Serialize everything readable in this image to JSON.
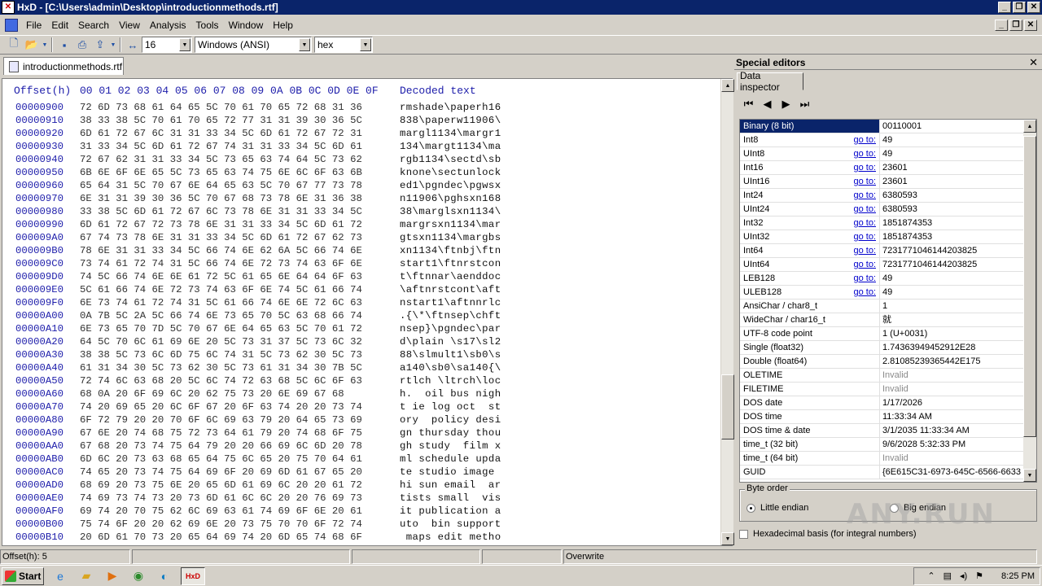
{
  "title": "HxD - [C:\\Users\\admin\\Desktop\\introductionmethods.rtf]",
  "menu": [
    "File",
    "Edit",
    "Search",
    "View",
    "Analysis",
    "Tools",
    "Window",
    "Help"
  ],
  "toolbar": {
    "bytes_per_row": "16",
    "charset": "Windows (ANSI)",
    "offset_base": "hex"
  },
  "file_tab": "introductionmethods.rtf",
  "hex": {
    "header_offset": "Offset(h)",
    "header_columns": [
      "00",
      "01",
      "02",
      "03",
      "04",
      "05",
      "06",
      "07",
      "08",
      "09",
      "0A",
      "0B",
      "0C",
      "0D",
      "0E",
      "0F"
    ],
    "header_decoded": "Decoded text",
    "rows": [
      {
        "off": "00000900",
        "bytes": "72 6D 73 68 61 64 65 5C 70 61 70 65 72 68 31 36",
        "text": "rmshade\\paperh16"
      },
      {
        "off": "00000910",
        "bytes": "38 33 38 5C 70 61 70 65 72 77 31 31 39 30 36 5C",
        "text": "838\\paperw11906\\"
      },
      {
        "off": "00000920",
        "bytes": "6D 61 72 67 6C 31 31 33 34 5C 6D 61 72 67 72 31",
        "text": "margl1134\\margr1"
      },
      {
        "off": "00000930",
        "bytes": "31 33 34 5C 6D 61 72 67 74 31 31 33 34 5C 6D 61",
        "text": "134\\margt1134\\ma"
      },
      {
        "off": "00000940",
        "bytes": "72 67 62 31 31 33 34 5C 73 65 63 74 64 5C 73 62",
        "text": "rgb1134\\sectd\\sb"
      },
      {
        "off": "00000950",
        "bytes": "6B 6E 6F 6E 65 5C 73 65 63 74 75 6E 6C 6F 63 6B",
        "text": "knone\\sectunlock"
      },
      {
        "off": "00000960",
        "bytes": "65 64 31 5C 70 67 6E 64 65 63 5C 70 67 77 73 78",
        "text": "ed1\\pgndec\\pgwsx"
      },
      {
        "off": "00000970",
        "bytes": "6E 31 31 39 30 36 5C 70 67 68 73 78 6E 31 36 38",
        "text": "n11906\\pghsxn168"
      },
      {
        "off": "00000980",
        "bytes": "33 38 5C 6D 61 72 67 6C 73 78 6E 31 31 33 34 5C",
        "text": "38\\marglsxn1134\\"
      },
      {
        "off": "00000990",
        "bytes": "6D 61 72 67 72 73 78 6E 31 31 33 34 5C 6D 61 72",
        "text": "margrsxn1134\\mar"
      },
      {
        "off": "000009A0",
        "bytes": "67 74 73 78 6E 31 31 33 34 5C 6D 61 72 67 62 73",
        "text": "gtsxn1134\\margbs"
      },
      {
        "off": "000009B0",
        "bytes": "78 6E 31 31 33 34 5C 66 74 6E 62 6A 5C 66 74 6E",
        "text": "xn1134\\ftnbj\\ftn"
      },
      {
        "off": "000009C0",
        "bytes": "73 74 61 72 74 31 5C 66 74 6E 72 73 74 63 6F 6E",
        "text": "start1\\ftnrstcon"
      },
      {
        "off": "000009D0",
        "bytes": "74 5C 66 74 6E 6E 61 72 5C 61 65 6E 64 64 6F 63",
        "text": "t\\ftnnar\\aenddoc"
      },
      {
        "off": "000009E0",
        "bytes": "5C 61 66 74 6E 72 73 74 63 6F 6E 74 5C 61 66 74",
        "text": "\\aftnrstcont\\aft"
      },
      {
        "off": "000009F0",
        "bytes": "6E 73 74 61 72 74 31 5C 61 66 74 6E 6E 72 6C 63",
        "text": "nstart1\\aftnnrlc"
      },
      {
        "off": "00000A00",
        "bytes": "0A 7B 5C 2A 5C 66 74 6E 73 65 70 5C 63 68 66 74",
        "text": ".{\\*\\ftnsep\\chft"
      },
      {
        "off": "00000A10",
        "bytes": "6E 73 65 70 7D 5C 70 67 6E 64 65 63 5C 70 61 72",
        "text": "nsep}\\pgndec\\par"
      },
      {
        "off": "00000A20",
        "bytes": "64 5C 70 6C 61 69 6E 20 5C 73 31 37 5C 73 6C 32",
        "text": "d\\plain \\s17\\sl2"
      },
      {
        "off": "00000A30",
        "bytes": "38 38 5C 73 6C 6D 75 6C 74 31 5C 73 62 30 5C 73",
        "text": "88\\slmult1\\sb0\\s"
      },
      {
        "off": "00000A40",
        "bytes": "61 31 34 30 5C 73 62 30 5C 73 61 31 34 30 7B 5C",
        "text": "a140\\sb0\\sa140{\\"
      },
      {
        "off": "00000A50",
        "bytes": "72 74 6C 63 68 20 5C 6C 74 72 63 68 5C 6C 6F 63",
        "text": "rtlch \\ltrch\\loc"
      },
      {
        "off": "00000A60",
        "bytes": "68 0A 20 6F 69 6C 20 62 75 73 20 6E 69 67 68",
        "text": "h.  oil bus nigh"
      },
      {
        "off": "00000A70",
        "bytes": "74 20 69 65 20 6C 6F 67 20 6F 63 74 20 20 73 74",
        "text": "t ie log oct  st"
      },
      {
        "off": "00000A80",
        "bytes": "6F 72 79 20 20 70 6F 6C 69 63 79 20 64 65 73 69",
        "text": "ory  policy desi"
      },
      {
        "off": "00000A90",
        "bytes": "67 6E 20 74 68 75 72 73 64 61 79 20 74 68 6F 75",
        "text": "gn thursday thou"
      },
      {
        "off": "00000AA0",
        "bytes": "67 68 20 73 74 75 64 79 20 20 66 69 6C 6D 20 78",
        "text": "gh study  film x"
      },
      {
        "off": "00000AB0",
        "bytes": "6D 6C 20 73 63 68 65 64 75 6C 65 20 75 70 64 61",
        "text": "ml schedule upda"
      },
      {
        "off": "00000AC0",
        "bytes": "74 65 20 73 74 75 64 69 6F 20 69 6D 61 67 65 20",
        "text": "te studio image "
      },
      {
        "off": "00000AD0",
        "bytes": "68 69 20 73 75 6E 20 65 6D 61 69 6C 20 20 61 72",
        "text": "hi sun email  ar"
      },
      {
        "off": "00000AE0",
        "bytes": "74 69 73 74 73 20 73 6D 61 6C 6C 20 20 76 69 73",
        "text": "tists small  vis"
      },
      {
        "off": "00000AF0",
        "bytes": "69 74 20 70 75 62 6C 69 63 61 74 69 6F 6E 20 61",
        "text": "it publication a"
      },
      {
        "off": "00000B00",
        "bytes": "75 74 6F 20 20 62 69 6E 20 73 75 70 70 6F 72 74",
        "text": "uto  bin support"
      },
      {
        "off": "00000B10",
        "bytes": "20 6D 61 70 73 20 65 64 69 74 20 6D 65 74 68 6F",
        "text": " maps edit metho"
      }
    ]
  },
  "special_editors": {
    "title": "Special editors",
    "tab": "Data inspector",
    "goto_label": "go to:",
    "rows": [
      {
        "name": "Binary (8 bit)",
        "value": "00110001",
        "goto": false,
        "invalid": false,
        "selected": true
      },
      {
        "name": "Int8",
        "value": "49",
        "goto": true,
        "invalid": false
      },
      {
        "name": "UInt8",
        "value": "49",
        "goto": true,
        "invalid": false
      },
      {
        "name": "Int16",
        "value": "23601",
        "goto": true,
        "invalid": false
      },
      {
        "name": "UInt16",
        "value": "23601",
        "goto": true,
        "invalid": false
      },
      {
        "name": "Int24",
        "value": "6380593",
        "goto": true,
        "invalid": false
      },
      {
        "name": "UInt24",
        "value": "6380593",
        "goto": true,
        "invalid": false
      },
      {
        "name": "Int32",
        "value": "1851874353",
        "goto": true,
        "invalid": false
      },
      {
        "name": "UInt32",
        "value": "1851874353",
        "goto": true,
        "invalid": false
      },
      {
        "name": "Int64",
        "value": "7231771046144203825",
        "goto": true,
        "invalid": false
      },
      {
        "name": "UInt64",
        "value": "7231771046144203825",
        "goto": true,
        "invalid": false
      },
      {
        "name": "LEB128",
        "value": "49",
        "goto": true,
        "invalid": false
      },
      {
        "name": "ULEB128",
        "value": "49",
        "goto": true,
        "invalid": false
      },
      {
        "name": "AnsiChar / char8_t",
        "value": "1",
        "goto": false,
        "invalid": false
      },
      {
        "name": "WideChar / char16_t",
        "value": "就",
        "goto": false,
        "invalid": false
      },
      {
        "name": "UTF-8 code point",
        "value": "1 (U+0031)",
        "goto": false,
        "invalid": false
      },
      {
        "name": "Single (float32)",
        "value": "1.74363949452912E28",
        "goto": false,
        "invalid": false
      },
      {
        "name": "Double (float64)",
        "value": "2.81085239365442E175",
        "goto": false,
        "invalid": false
      },
      {
        "name": "OLETIME",
        "value": "Invalid",
        "goto": false,
        "invalid": true
      },
      {
        "name": "FILETIME",
        "value": "Invalid",
        "goto": false,
        "invalid": true
      },
      {
        "name": "DOS date",
        "value": "1/17/2026",
        "goto": false,
        "invalid": false
      },
      {
        "name": "DOS time",
        "value": "11:33:34 AM",
        "goto": false,
        "invalid": false
      },
      {
        "name": "DOS time & date",
        "value": "3/1/2035 11:33:34 AM",
        "goto": false,
        "invalid": false
      },
      {
        "name": "time_t (32 bit)",
        "value": "9/6/2028 5:32:33 PM",
        "goto": false,
        "invalid": false
      },
      {
        "name": "time_t (64 bit)",
        "value": "Invalid",
        "goto": false,
        "invalid": true
      },
      {
        "name": "GUID",
        "value": "{6E615C31-6973-645C-6566-6633",
        "goto": false,
        "invalid": false
      }
    ],
    "byte_order_label": "Byte order",
    "little_endian": "Little endian",
    "big_endian": "Big endian",
    "hex_basis": "Hexadecimal basis (for integral numbers)"
  },
  "status": {
    "offset": "Offset(h): 5",
    "mode": "Overwrite"
  },
  "taskbar": {
    "start": "Start",
    "clock": "8:25 PM"
  },
  "watermark": "ANY.RUN"
}
